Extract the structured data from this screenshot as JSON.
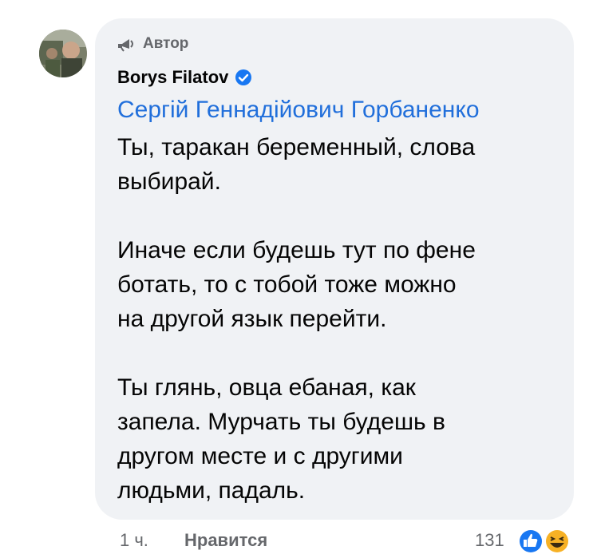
{
  "comment": {
    "author_badge_label": "Автор",
    "author_name": "Borys Filatov",
    "mention": "Сергій Геннадійович Горбаненко",
    "paragraphs": [
      "Ты, таракан беременный, слова\nвыбирай.",
      "Иначе если будешь тут по фене\nботать, то с тобой тоже можно\nна другой язык перейти.",
      "Ты глянь, овца ебаная, как\nзапела. Мурчать ты будешь в\nдругом месте и с другими\nлюдьми, падаль."
    ]
  },
  "footer": {
    "time": "1 ч.",
    "like_label": "Нравится",
    "reaction_count": "131"
  },
  "colors": {
    "bubble_bg": "#f0f2f5",
    "link_blue": "#216fdb",
    "verified_blue": "#1877f2",
    "secondary_text": "#65676b",
    "like_reaction": "#1877f2",
    "haha_reaction": "#f7b125"
  },
  "icons": {
    "author_badge": "megaphone-icon",
    "verified": "verified-badge-icon",
    "reactions": [
      "like-reaction-icon",
      "haha-reaction-icon"
    ]
  }
}
